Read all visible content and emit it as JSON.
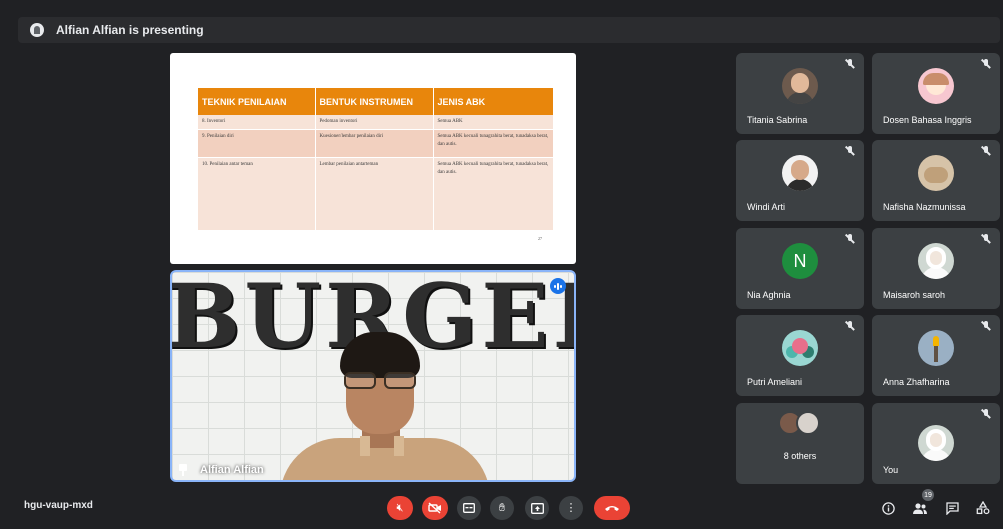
{
  "presenting_banner": {
    "text": "Alfian Alfian is presenting"
  },
  "slide": {
    "headers": [
      "TEKNIK PENILAIAN",
      "BENTUK INSTRUMEN",
      "JENIS ABK"
    ],
    "rows": [
      [
        "8. Inventori",
        "Pedoman inventori",
        "Semua ABK"
      ],
      [
        "9. Penilaian diri",
        "Kuesioner/lembar penilaian diri",
        "Semua ABK kecuali tunagrahita berat, tunadaksa berat, dan autis."
      ],
      [
        "10. Penilaian antar    teman",
        "Lembar penilaian antarteman",
        "Semua ABK kecuali tunagrahita berat, tunadaksa berat, dan autis."
      ]
    ],
    "page_number": "27"
  },
  "main_video": {
    "background_text": "BURGER",
    "name": "Alfian Alfian"
  },
  "participants": [
    {
      "name": "Titania Sabrina",
      "avatar": "photo"
    },
    {
      "name": "Dosen Bahasa Inggris",
      "avatar": "cartoon"
    },
    {
      "name": "Windi Arti",
      "avatar": "photo"
    },
    {
      "name": "Nafisha Nazmunissa",
      "avatar": "cat"
    },
    {
      "name": "Nia Aghnia",
      "avatar": "letter",
      "letter": "N"
    },
    {
      "name": "Maisaroh saroh",
      "avatar": "hijab"
    },
    {
      "name": "Putri Ameliani",
      "avatar": "flower"
    },
    {
      "name": "Anna Zhafharina",
      "avatar": "torch"
    },
    {
      "name": "8 others",
      "avatar": "group"
    },
    {
      "name": "You",
      "avatar": "hijab"
    }
  ],
  "bottom_bar": {
    "meeting_code": "hgu-vaup-mxd",
    "participant_count": "19"
  },
  "colors": {
    "background": "#202124",
    "tile": "#3c4043",
    "end_call": "#ea4335",
    "accent": "#1a73e8",
    "slide_header": "#e8860c"
  }
}
